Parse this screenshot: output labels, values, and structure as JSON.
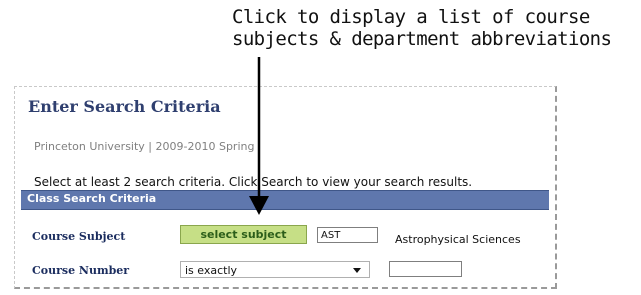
{
  "callout": {
    "line1": "Click to display a list of course",
    "line2": "subjects & department abbreviations"
  },
  "page": {
    "title": "Enter Search Criteria",
    "breadcrumb": "Princeton University | 2009-2010 Spring",
    "instructions": "Select at least 2 search criteria. Click Search to view your search results."
  },
  "section": {
    "header": "Class Search Criteria"
  },
  "form": {
    "course_subject": {
      "label": "Course Subject",
      "button": "select subject",
      "value": "AST",
      "description": "Astrophysical Sciences"
    },
    "course_number": {
      "label": "Course Number",
      "operator": "is exactly",
      "value": ""
    }
  },
  "colors": {
    "header_bar": "#5f77ad",
    "button_bg": "#c6df86",
    "title_text": "#2f3f6f"
  },
  "icons": {
    "dropdown": "chevron-down-icon",
    "pointer": "arrow-icon"
  }
}
